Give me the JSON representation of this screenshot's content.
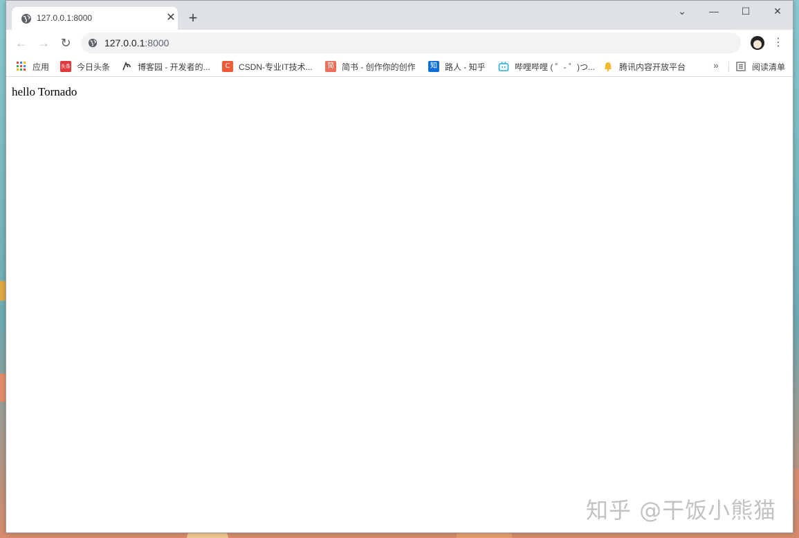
{
  "tab": {
    "title": "127.0.0.1:8000",
    "close_glyph": "✕"
  },
  "new_tab_glyph": "+",
  "window_controls": {
    "minimize": "—",
    "maximize": "☐",
    "close": "✕",
    "tabsearch": "⌄"
  },
  "toolbar": {
    "back_glyph": "←",
    "forward_glyph": "→",
    "reload_glyph": "↻",
    "url_host": "127.0.0.1",
    "url_port": ":8000",
    "menu_glyph": "⋮"
  },
  "bookmarks": {
    "items": [
      {
        "label": "应用",
        "icon": "apps-grid-icon"
      },
      {
        "label": "今日头条",
        "icon": "toutiao-icon",
        "icon_text": "头条",
        "color": "#e0393e"
      },
      {
        "label": "博客园 - 开发者的...",
        "icon": "cnblogs-icon"
      },
      {
        "label": "CSDN-专业IT技术...",
        "icon": "csdn-icon",
        "icon_text": "C",
        "color": "#f05a38"
      },
      {
        "label": "简书 - 创作你的创作",
        "icon": "jianshu-icon",
        "icon_text": "简",
        "color": "#ea6f5a"
      },
      {
        "label": "路人 - 知乎",
        "icon": "zhihu-icon",
        "icon_text": "知",
        "color": "#0e6fd8"
      },
      {
        "label": "哔哩哔哩 ( ゜- ゜)つ...",
        "icon": "bilibili-icon",
        "color": "#23ade5"
      },
      {
        "label": "腾讯内容开放平台",
        "icon": "tencent-icon",
        "color": "#f5b82e"
      }
    ],
    "more_glyph": "»",
    "reading_list": "阅读清单"
  },
  "page": {
    "text": "hello Tornado"
  },
  "watermark": "知乎 @干饭小熊猫"
}
